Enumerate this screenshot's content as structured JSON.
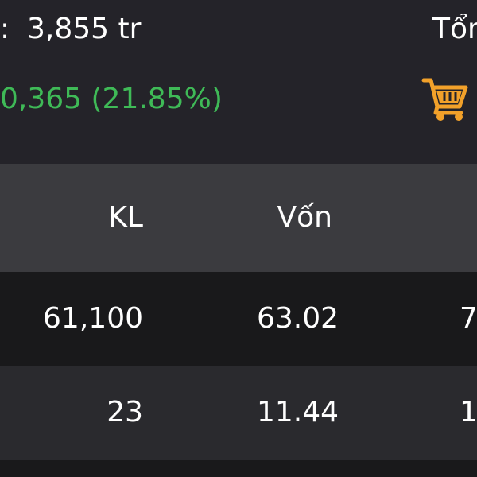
{
  "summary": {
    "line1_colon": ":",
    "line1_value": "3,855 tr",
    "total_label_partial": "Tổn",
    "line2_value": "0,365 (21.85%)"
  },
  "icons": {
    "cart": "cart-icon"
  },
  "colors": {
    "background": "#242329",
    "header": "#3b3b3f",
    "row_dark": "#19191b",
    "row_alt": "#2a2a2e",
    "positive": "#3fba57",
    "cart": "#f2a12a"
  },
  "table": {
    "columns": [
      "KL",
      "Vốn"
    ],
    "rows": [
      {
        "kl": "61,100",
        "von": "63.02",
        "third_partial": "7"
      },
      {
        "kl": "23",
        "von": "11.44",
        "third_partial": "1"
      }
    ]
  }
}
